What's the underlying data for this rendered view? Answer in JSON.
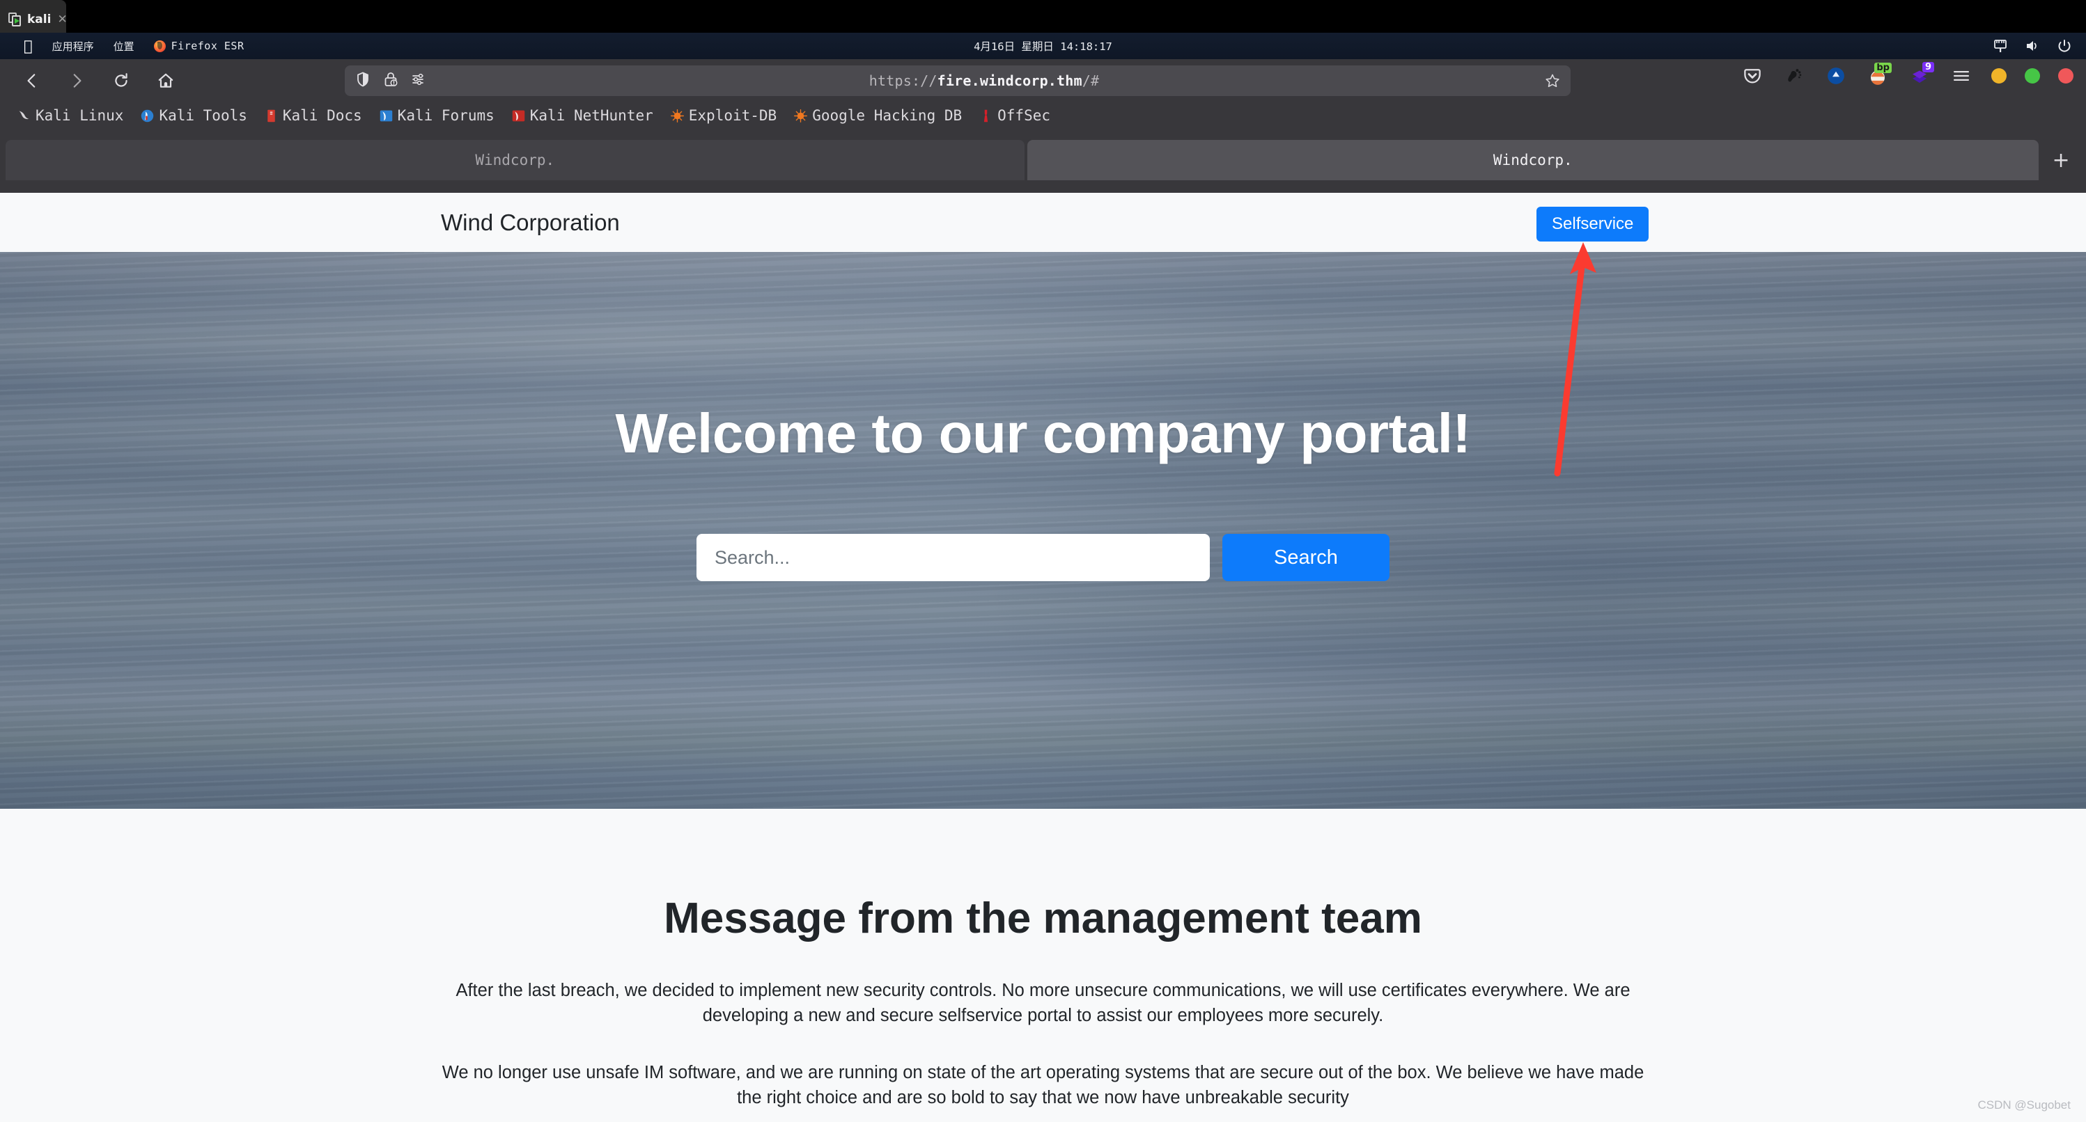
{
  "vm": {
    "tab_label": "kali",
    "close_label": "✕",
    "icon": "vm-window-icon"
  },
  "panel": {
    "apple_label": "",
    "applications_label": "应用程序",
    "places_label": "位置",
    "firefox_label": "Firefox ESR",
    "clock": "4月16日 星期日 14:18:17",
    "tray": [
      "network-icon",
      "volume-icon",
      "power-icon"
    ]
  },
  "browser": {
    "nav": {
      "back": "back-icon",
      "forward": "forward-icon",
      "reload": "reload-icon",
      "home": "home-icon"
    },
    "urlbar": {
      "url_prefix": "https://",
      "url_domain": "fire.windcorp.thm",
      "url_suffix": "/#",
      "full_url": "https://fire.windcorp.thm/#",
      "icons": [
        "shield-icon",
        "lock-warning-icon",
        "permissions-icon"
      ],
      "bookmark_star": "star-icon"
    },
    "toolbar_right": [
      {
        "name": "pocket-icon",
        "badge": ""
      },
      {
        "name": "gnome-foot-icon",
        "badge": ""
      },
      {
        "name": "account-circle-icon",
        "badge": ""
      },
      {
        "name": "foxyproxy-icon",
        "badge": "bp"
      },
      {
        "name": "extension-icon",
        "badge": "9"
      },
      {
        "name": "hamburger-menu-icon",
        "badge": ""
      }
    ],
    "window_controls": {
      "minimize_color": "#f0b429",
      "maximize_color": "#46c646",
      "close_color": "#f0585a"
    },
    "bookmarks": [
      {
        "label": "Kali Linux",
        "icon": "kali-dragon-icon"
      },
      {
        "label": "Kali Tools",
        "icon": "kali-tools-icon"
      },
      {
        "label": "Kali Docs",
        "icon": "kali-docs-icon"
      },
      {
        "label": "Kali Forums",
        "icon": "kali-forums-icon"
      },
      {
        "label": "Kali NetHunter",
        "icon": "kali-nethunter-icon"
      },
      {
        "label": "Exploit-DB",
        "icon": "exploit-db-icon"
      },
      {
        "label": "Google Hacking DB",
        "icon": "google-hacking-db-icon"
      },
      {
        "label": "OffSec",
        "icon": "offsec-icon"
      }
    ],
    "tabs": [
      {
        "title": "Windcorp.",
        "active": false
      },
      {
        "title": "Windcorp.",
        "active": true
      }
    ],
    "new_tab_label": "+"
  },
  "page": {
    "brand": "Wind Corporation",
    "selfservice_label": "Selfservice",
    "hero_heading": "Welcome to our company portal!",
    "search_placeholder": "Search...",
    "search_value": "",
    "search_button_label": "Search",
    "message_heading": "Message from the management team",
    "paragraph_1": "After the last breach, we decided to implement new security controls. No more unsecure communications, we will use certificates everywhere. We are developing a new and secure selfservice portal to assist our employees more securely.",
    "paragraph_2": "We no longer use unsafe IM software, and we are running on state of the art operating systems that are secure out of the box. We believe we have made the right choice and are so bold to say that we now have unbreakable security"
  },
  "annotation": {
    "type": "arrow",
    "color": "#fb3b30",
    "points_to": "selfservice-button"
  },
  "watermark": "CSDN @Sugobet",
  "colors": {
    "accent_blue": "#0d7bfb",
    "panel_bg": "#131d2e",
    "chrome_bg": "#38373b",
    "page_bg": "#f8f9fa"
  }
}
